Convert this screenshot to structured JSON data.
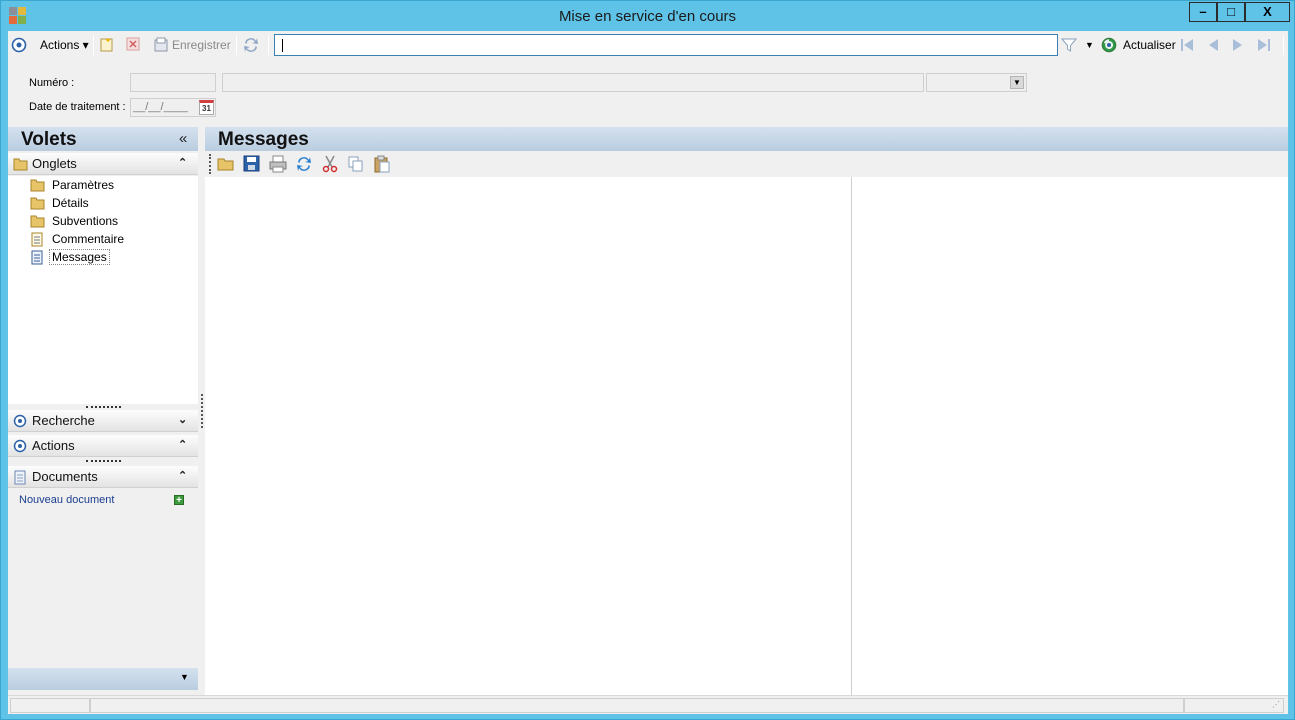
{
  "window": {
    "title": "Mise en service d'en cours",
    "min_glyph": "–",
    "max_glyph": "□",
    "close_glyph": "X"
  },
  "toolbar": {
    "actions_label": "Actions ▾",
    "save_label": "Enregistrer",
    "search_value": "",
    "refresh_label": "Actualiser"
  },
  "form": {
    "numero_label": "Numéro :",
    "date_label": "Date de traitement :",
    "date_placeholder": "__/__/____",
    "calendar_day": "31"
  },
  "left_panel": {
    "title": "Volets",
    "collapse_glyph": "«",
    "onglets": {
      "label": "Onglets",
      "items": [
        {
          "label": "Paramètres",
          "icon": "folder-icon"
        },
        {
          "label": "Détails",
          "icon": "folder-icon"
        },
        {
          "label": "Subventions",
          "icon": "folder-icon"
        },
        {
          "label": "Commentaire",
          "icon": "document-icon"
        },
        {
          "label": "Messages",
          "icon": "document-icon",
          "selected": true
        }
      ]
    },
    "recherche_label": "Recherche",
    "actions_label": "Actions",
    "documents_label": "Documents",
    "new_document_label": "Nouveau document"
  },
  "main_panel": {
    "title": "Messages",
    "toolbar_icons": [
      "folder-open-icon",
      "save-icon",
      "print-icon",
      "refresh-icon",
      "cut-icon",
      "copy-icon",
      "paste-icon"
    ]
  },
  "colors": {
    "titlebar": "#5fc3e8",
    "panel_header": "#c9d9e8",
    "link": "#1a3d8f"
  }
}
